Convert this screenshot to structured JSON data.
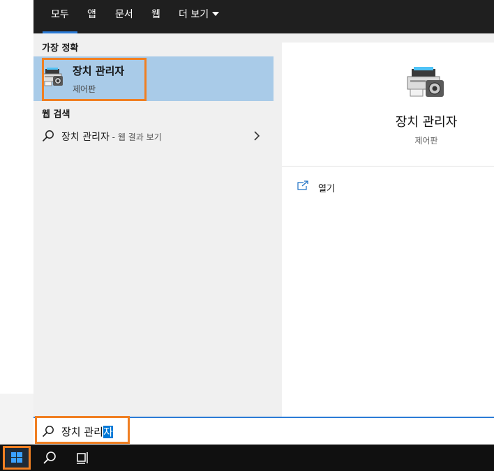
{
  "tabs": [
    {
      "label": "모두",
      "active": true
    },
    {
      "label": "앱"
    },
    {
      "label": "문서"
    },
    {
      "label": "웹"
    },
    {
      "label": "더 보기"
    }
  ],
  "best_match": {
    "section_label": "가장 정확",
    "title": "장치 관리자",
    "subtitle": "제어판",
    "icon": "device-manager-icon"
  },
  "web_search": {
    "section_label": "웹 검색",
    "query": "장치 관리자",
    "suffix": " - 웹 결과 보기"
  },
  "detail": {
    "title": "장치 관리자",
    "subtitle": "제어판",
    "actions": [
      {
        "label": "열기",
        "icon": "open-icon"
      }
    ]
  },
  "search_box": {
    "text_before": "장치 관리",
    "text_selected": "자"
  },
  "colors": {
    "accent": "#2b7bd6",
    "highlight_outline": "#f07f22",
    "selection_bg": "#a9cbe8",
    "tab_bar": "#1f1f1f",
    "taskbar": "#101010"
  }
}
